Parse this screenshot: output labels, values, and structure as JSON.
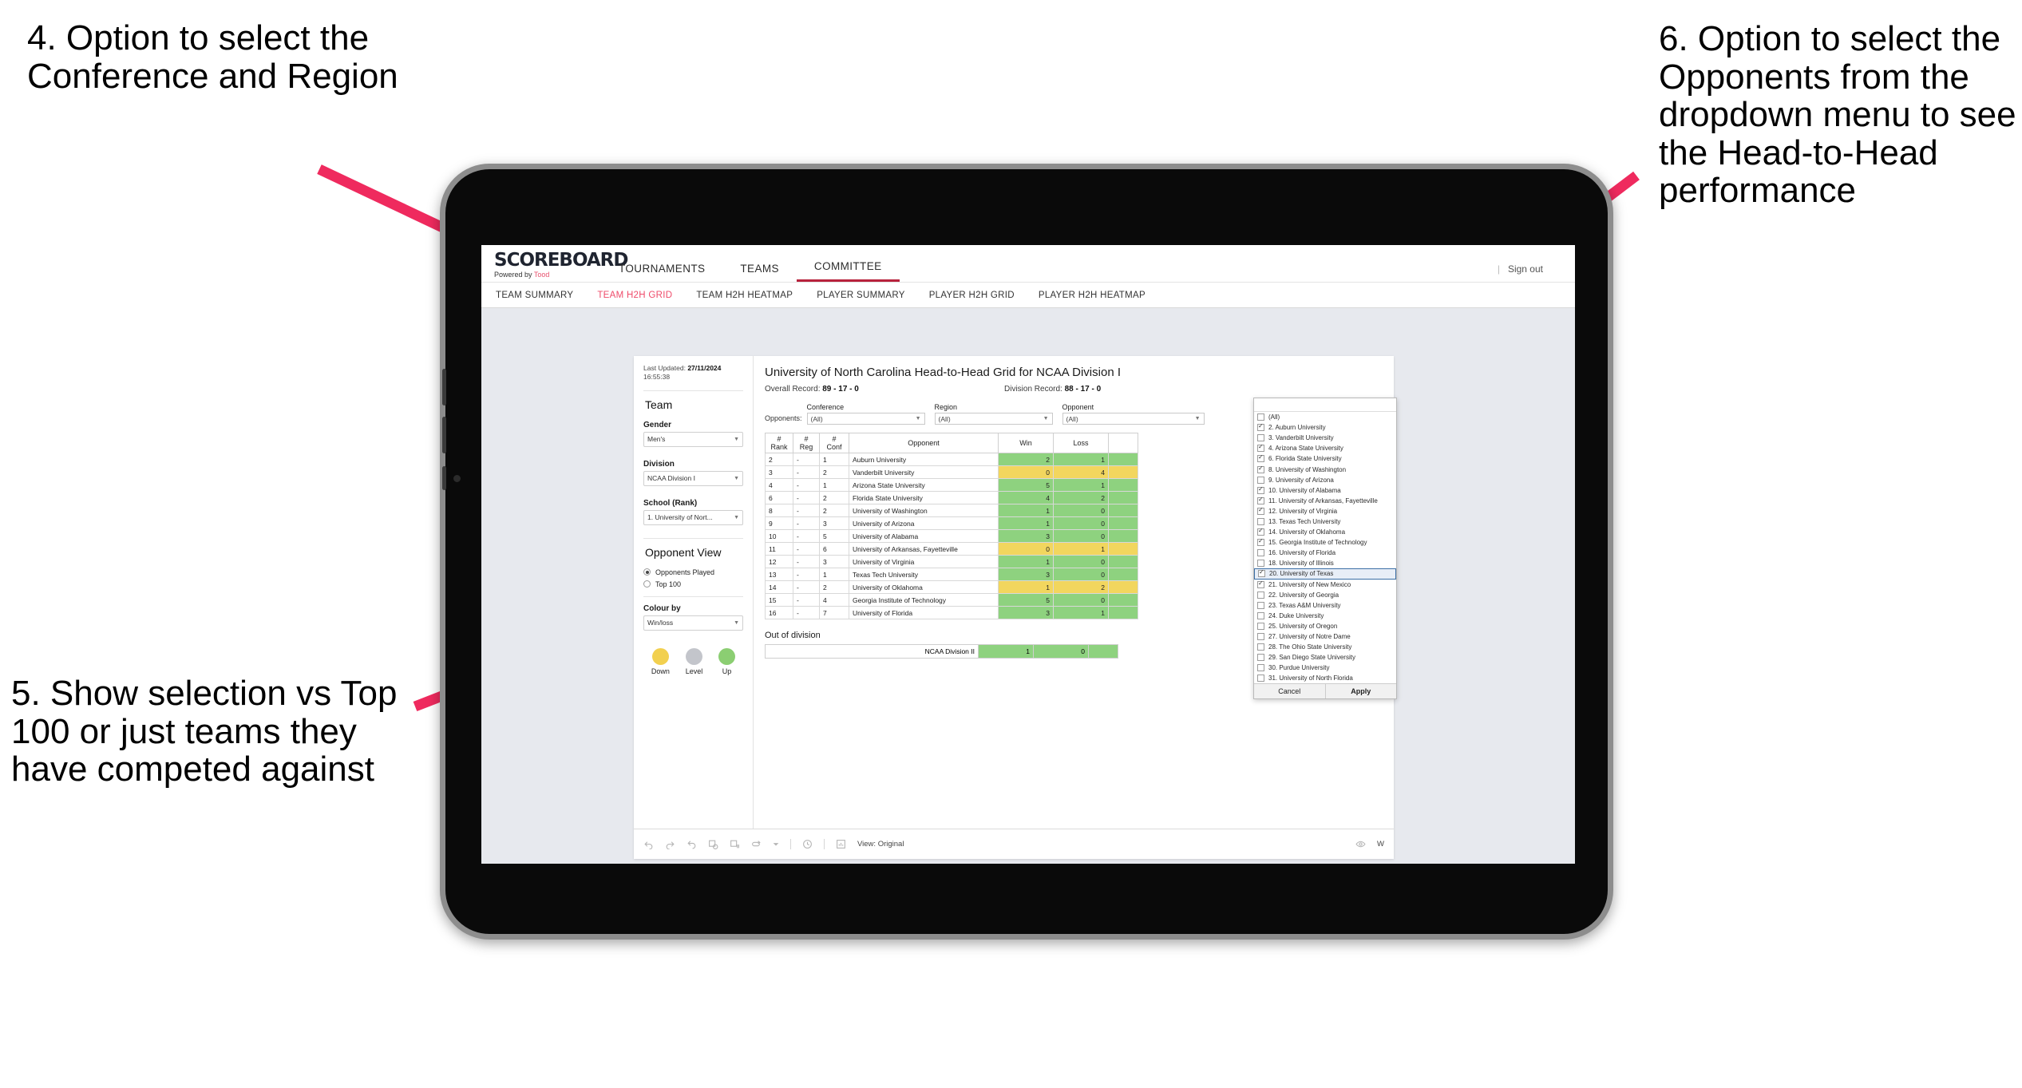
{
  "annotations": [
    {
      "id": "a4",
      "text": "4. Option to select the Conference and Region"
    },
    {
      "id": "a5",
      "text": "5. Show selection vs Top 100 or just teams they have competed against"
    },
    {
      "id": "a6",
      "text": "6. Option to select the Opponents from the dropdown menu to see the Head-to-Head performance"
    }
  ],
  "annotation_color": "#ef2a5e",
  "app": {
    "brand": {
      "name": "SCOREBOARD",
      "tagline_prefix": "Powered by ",
      "tagline_suffix": "Tood"
    },
    "topnav": [
      {
        "label": "TOURNAMENTS",
        "active": false
      },
      {
        "label": "TEAMS",
        "active": false
      },
      {
        "label": "COMMITTEE",
        "active": true
      }
    ],
    "signout": {
      "separator": "|",
      "label": "Sign out"
    },
    "subnav": [
      {
        "label": "TEAM SUMMARY",
        "active": false
      },
      {
        "label": "TEAM H2H GRID",
        "active": true
      },
      {
        "label": "TEAM H2H HEATMAP",
        "active": false
      },
      {
        "label": "PLAYER SUMMARY",
        "active": false
      },
      {
        "label": "PLAYER H2H GRID",
        "active": false
      },
      {
        "label": "PLAYER H2H HEATMAP",
        "active": false
      }
    ]
  },
  "panel": {
    "last_updated_label": "Last Updated:",
    "last_updated_date": "27/11/2024",
    "last_updated_time": "16:55:38",
    "team_group_title": "Team",
    "gender_label": "Gender",
    "gender_value": "Men's",
    "division_label": "Division",
    "division_value": "NCAA Division I",
    "school_label": "School (Rank)",
    "school_value": "1. University of Nort...",
    "opponent_view_title": "Opponent View",
    "opponent_view_options": [
      {
        "label": "Opponents Played",
        "selected": true
      },
      {
        "label": "Top 100",
        "selected": false
      }
    ],
    "colour_by_label": "Colour by",
    "colour_by_value": "Win/loss",
    "legend": [
      {
        "label": "Down",
        "color": "#f2d04f"
      },
      {
        "label": "Level",
        "color": "#c3c5cb"
      },
      {
        "label": "Up",
        "color": "#8bce72"
      }
    ]
  },
  "viz": {
    "title": "University of North Carolina Head-to-Head Grid for NCAA Division I",
    "overall_record_label": "Overall Record:",
    "overall_record_value": "89 - 17 - 0",
    "division_record_label": "Division Record:",
    "division_record_value": "88 - 17 - 0",
    "opponents_label": "Opponents:",
    "filters": [
      {
        "label": "Conference",
        "value": "(All)"
      },
      {
        "label": "Region",
        "value": "(All)"
      },
      {
        "label": "Opponent",
        "value": "(All)"
      }
    ],
    "out_of_division_title": "Out of division",
    "out_of_division_row": {
      "name": "NCAA Division II",
      "win": "1",
      "loss": "0"
    }
  },
  "chart_data": {
    "type": "table",
    "title": "University of North Carolina Head-to-Head Grid for NCAA Division I",
    "columns": [
      "# Rank",
      "# Reg",
      "# Conf",
      "Opponent",
      "Win",
      "Loss"
    ],
    "column_headers_wrapped": [
      {
        "l1": "#",
        "l2": "Rank"
      },
      {
        "l1": "#",
        "l2": "Reg"
      },
      {
        "l1": "#",
        "l2": "Conf"
      },
      {
        "l1": "",
        "l2": "Opponent"
      },
      {
        "l1": "",
        "l2": "Win"
      },
      {
        "l1": "",
        "l2": "Loss"
      }
    ],
    "rows": [
      {
        "rank": "2",
        "reg": "-",
        "conf": "1",
        "opponent": "Auburn University",
        "win": "2",
        "loss": "1",
        "result": "win"
      },
      {
        "rank": "3",
        "reg": "-",
        "conf": "2",
        "opponent": "Vanderbilt University",
        "win": "0",
        "loss": "4",
        "result": "loss"
      },
      {
        "rank": "4",
        "reg": "-",
        "conf": "1",
        "opponent": "Arizona State University",
        "win": "5",
        "loss": "1",
        "result": "win"
      },
      {
        "rank": "6",
        "reg": "-",
        "conf": "2",
        "opponent": "Florida State University",
        "win": "4",
        "loss": "2",
        "result": "win"
      },
      {
        "rank": "8",
        "reg": "-",
        "conf": "2",
        "opponent": "University of Washington",
        "win": "1",
        "loss": "0",
        "result": "win"
      },
      {
        "rank": "9",
        "reg": "-",
        "conf": "3",
        "opponent": "University of Arizona",
        "win": "1",
        "loss": "0",
        "result": "win"
      },
      {
        "rank": "10",
        "reg": "-",
        "conf": "5",
        "opponent": "University of Alabama",
        "win": "3",
        "loss": "0",
        "result": "win"
      },
      {
        "rank": "11",
        "reg": "-",
        "conf": "6",
        "opponent": "University of Arkansas, Fayetteville",
        "win": "0",
        "loss": "1",
        "result": "loss"
      },
      {
        "rank": "12",
        "reg": "-",
        "conf": "3",
        "opponent": "University of Virginia",
        "win": "1",
        "loss": "0",
        "result": "win"
      },
      {
        "rank": "13",
        "reg": "-",
        "conf": "1",
        "opponent": "Texas Tech University",
        "win": "3",
        "loss": "0",
        "result": "win"
      },
      {
        "rank": "14",
        "reg": "-",
        "conf": "2",
        "opponent": "University of Oklahoma",
        "win": "1",
        "loss": "2",
        "result": "loss"
      },
      {
        "rank": "15",
        "reg": "-",
        "conf": "4",
        "opponent": "Georgia Institute of Technology",
        "win": "5",
        "loss": "0",
        "result": "win"
      },
      {
        "rank": "16",
        "reg": "-",
        "conf": "7",
        "opponent": "University of Florida",
        "win": "3",
        "loss": "1",
        "result": "win"
      }
    ],
    "colors": {
      "win": "#8ed27f",
      "loss": "#f2d65e"
    }
  },
  "opponent_dropdown": {
    "items": [
      {
        "label": "(All)",
        "checked": false,
        "highlighted": false
      },
      {
        "label": "2. Auburn University",
        "checked": true,
        "highlighted": false
      },
      {
        "label": "3. Vanderbilt University",
        "checked": false,
        "highlighted": false
      },
      {
        "label": "4. Arizona State University",
        "checked": true,
        "highlighted": false
      },
      {
        "label": "6. Florida State University",
        "checked": true,
        "highlighted": false
      },
      {
        "label": "8. University of Washington",
        "checked": true,
        "highlighted": false
      },
      {
        "label": "9. University of Arizona",
        "checked": false,
        "highlighted": false
      },
      {
        "label": "10. University of Alabama",
        "checked": true,
        "highlighted": false
      },
      {
        "label": "11. University of Arkansas, Fayetteville",
        "checked": true,
        "highlighted": false
      },
      {
        "label": "12. University of Virginia",
        "checked": true,
        "highlighted": false
      },
      {
        "label": "13. Texas Tech University",
        "checked": false,
        "highlighted": false
      },
      {
        "label": "14. University of Oklahoma",
        "checked": true,
        "highlighted": false
      },
      {
        "label": "15. Georgia Institute of Technology",
        "checked": true,
        "highlighted": false
      },
      {
        "label": "16. University of Florida",
        "checked": false,
        "highlighted": false
      },
      {
        "label": "18. University of Illinois",
        "checked": false,
        "highlighted": false
      },
      {
        "label": "20. University of Texas",
        "checked": true,
        "highlighted": true
      },
      {
        "label": "21. University of New Mexico",
        "checked": true,
        "highlighted": false
      },
      {
        "label": "22. University of Georgia",
        "checked": false,
        "highlighted": false
      },
      {
        "label": "23. Texas A&M University",
        "checked": false,
        "highlighted": false
      },
      {
        "label": "24. Duke University",
        "checked": false,
        "highlighted": false
      },
      {
        "label": "25. University of Oregon",
        "checked": false,
        "highlighted": false
      },
      {
        "label": "27. University of Notre Dame",
        "checked": false,
        "highlighted": false
      },
      {
        "label": "28. The Ohio State University",
        "checked": false,
        "highlighted": false
      },
      {
        "label": "29. San Diego State University",
        "checked": false,
        "highlighted": false
      },
      {
        "label": "30. Purdue University",
        "checked": false,
        "highlighted": false
      },
      {
        "label": "31. University of North Florida",
        "checked": false,
        "highlighted": false
      }
    ],
    "cancel_label": "Cancel",
    "apply_label": "Apply"
  },
  "toolbar": {
    "icons": [
      "undo-icon",
      "redo-icon",
      "revert-icon",
      "refresh-icon",
      "pause-icon",
      "share-icon",
      "chevron-down-icon",
      "clock-icon"
    ],
    "view_label": "View: Original",
    "watch_label": "W"
  }
}
